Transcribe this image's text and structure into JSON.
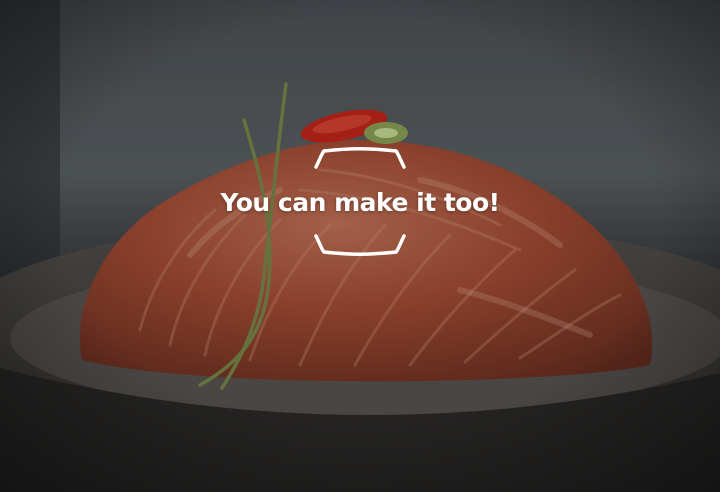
{
  "overlay": {
    "title": "You can make it too!"
  },
  "scene": {
    "subject": "kimchi-photo",
    "colors": {
      "background_top": "#5b6166",
      "background_bottom": "#2a2d30",
      "plate": "#4c4a48",
      "kimchi": "#b5553a",
      "kimchi_highlight": "#d98a6a",
      "chili": "#c8281c",
      "scallion": "#7a8a4a",
      "text": "#ffffff"
    }
  }
}
